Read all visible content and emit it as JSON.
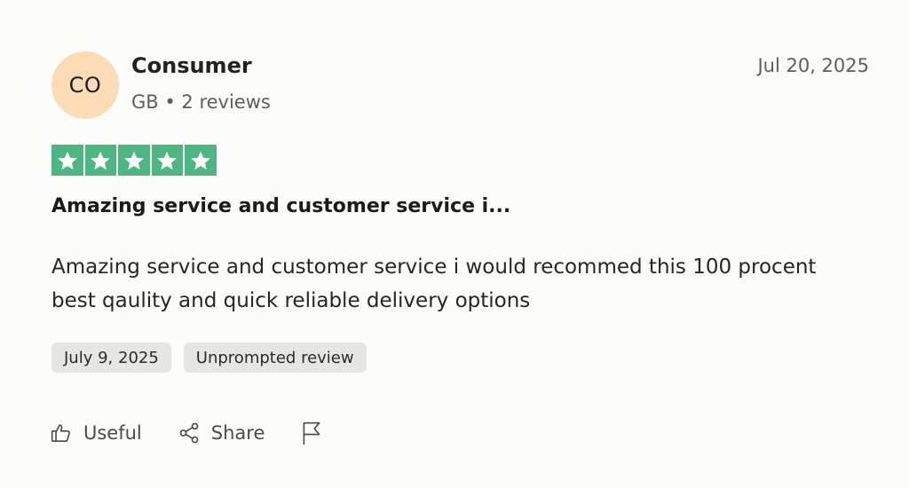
{
  "reviewer": {
    "initials": "CO",
    "name": "Consumer",
    "meta": "GB • 2 reviews"
  },
  "review": {
    "date": "Jul 20, 2025",
    "rating": 5,
    "rating_max": 5,
    "title": "Amazing service and customer service i...",
    "body": "Amazing service and customer service i would recommed this 100 procent best qaulity and quick reliable delivery options"
  },
  "tags": [
    {
      "label": "July 9, 2025"
    },
    {
      "label": "Unprompted review"
    }
  ],
  "actions": {
    "useful_label": "Useful",
    "share_label": "Share"
  },
  "icons": {
    "useful": "thumbs-up-icon",
    "share": "share-icon",
    "report": "flag-icon",
    "star": "star-icon"
  },
  "colors": {
    "star_green": "#4db681",
    "avatar_bg": "#fbdcb4",
    "chip_bg": "#e6e6e3"
  }
}
